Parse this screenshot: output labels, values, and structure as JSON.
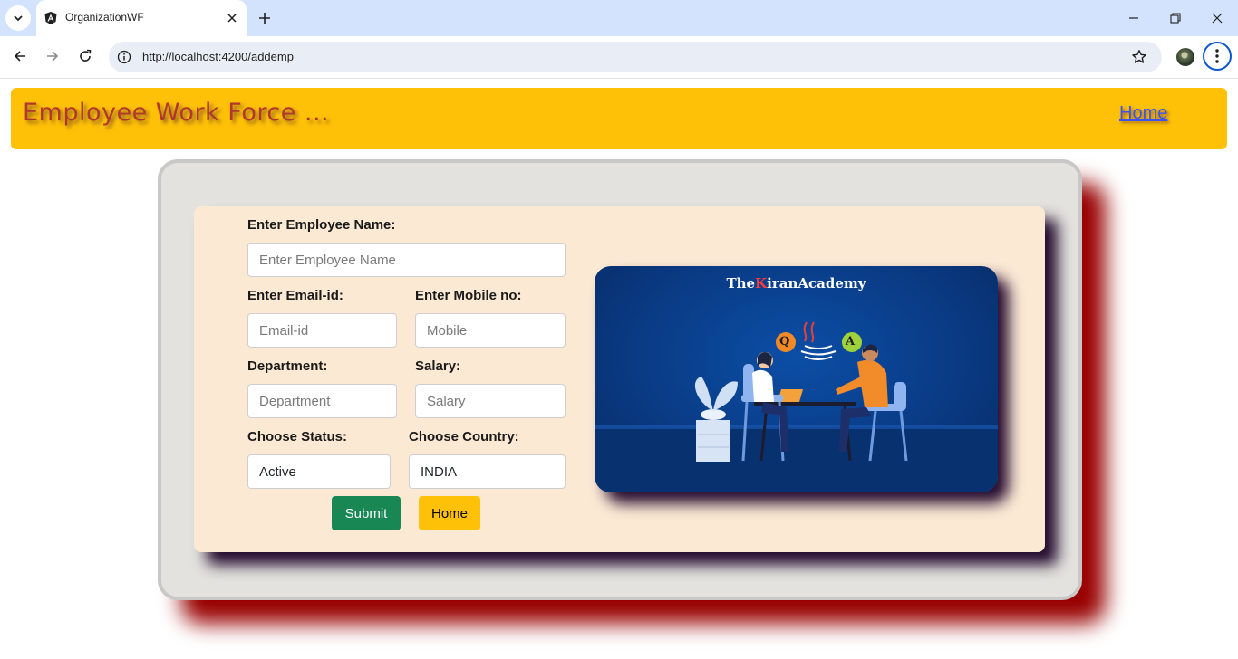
{
  "browser": {
    "tab": {
      "title": "OrganizationWF"
    },
    "address_bar": {
      "url": "http://localhost:4200/addemp"
    }
  },
  "header": {
    "brand": "Employee Work Force ...",
    "home_link": "Home"
  },
  "form": {
    "employee_name": {
      "label": "Enter Employee Name:",
      "placeholder": "Enter Employee Name"
    },
    "email": {
      "label": "Enter Email-id:",
      "placeholder": "Email-id"
    },
    "mobile": {
      "label": "Enter Mobile no:",
      "placeholder": "Mobile"
    },
    "department": {
      "label": "Department:",
      "placeholder": "Department"
    },
    "salary": {
      "label": "Salary:",
      "placeholder": "Salary"
    },
    "status": {
      "label": "Choose Status:",
      "selected": "Active"
    },
    "country": {
      "label": "Choose Country:",
      "selected": "INDIA"
    },
    "submit_label": "Submit",
    "home_label": "Home"
  },
  "promo": {
    "brand_prefix": "The",
    "brand_highlight": "K",
    "brand_suffix": "iranAcademy",
    "bubble_q": "Q",
    "bubble_a": "A"
  },
  "colors": {
    "banner": "#ffc107",
    "brand_text": "#b0382f",
    "submit_button": "#198754",
    "home_button": "#ffc107",
    "outer_card_shadow": "#990000",
    "form_card": "#fbe9d4"
  }
}
